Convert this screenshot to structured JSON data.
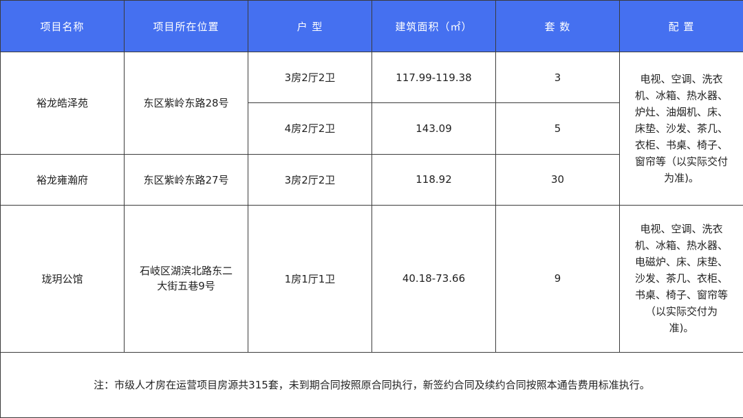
{
  "header": {
    "name": "项目名称",
    "location": "项目所在位置",
    "layout": "户 型",
    "area": "建筑面积（㎡）",
    "count": "套 数",
    "config": "配 置"
  },
  "projects": [
    {
      "name": "裕龙皓泽苑",
      "location": "东区紫岭东路28号",
      "units": [
        {
          "layout": "3房2厅2卫",
          "area": "117.99-119.38",
          "count": "3"
        },
        {
          "layout": "4房2厅2卫",
          "area": "143.09",
          "count": "5"
        }
      ]
    },
    {
      "name": "裕龙雍瀚府",
      "location": "东区紫岭东路27号",
      "units": [
        {
          "layout": "3房2厅2卫",
          "area": "118.92",
          "count": "30"
        }
      ]
    },
    {
      "name": "珑玥公馆",
      "location_line1": "石岐区湖滨北路东二",
      "location_line2": "大街五巷9号",
      "units": [
        {
          "layout": "1房1厅1卫",
          "area": "40.18-73.66",
          "count": "9"
        }
      ]
    }
  ],
  "configs": {
    "group1": [
      "电视、空调、洗衣",
      "机、冰箱、热水器、",
      "炉灶、油烟机、床、",
      "床垫、沙发、茶几、",
      "衣柜、书桌、椅子、",
      "窗帘等（以实际交付",
      "为准)。"
    ],
    "group2": [
      "电视、空调、洗衣",
      "机、冰箱、热水器、",
      "电磁炉、床、床垫、",
      "沙发、茶几、衣柜、",
      "书桌、椅子、窗帘等",
      "（以实际交付为",
      "准)。"
    ]
  },
  "note": "注：市级人才房在运营项目房源共315套，未到期合同按照原合同执行，新签约合同及续约合同按照本通告费用标准执行。"
}
